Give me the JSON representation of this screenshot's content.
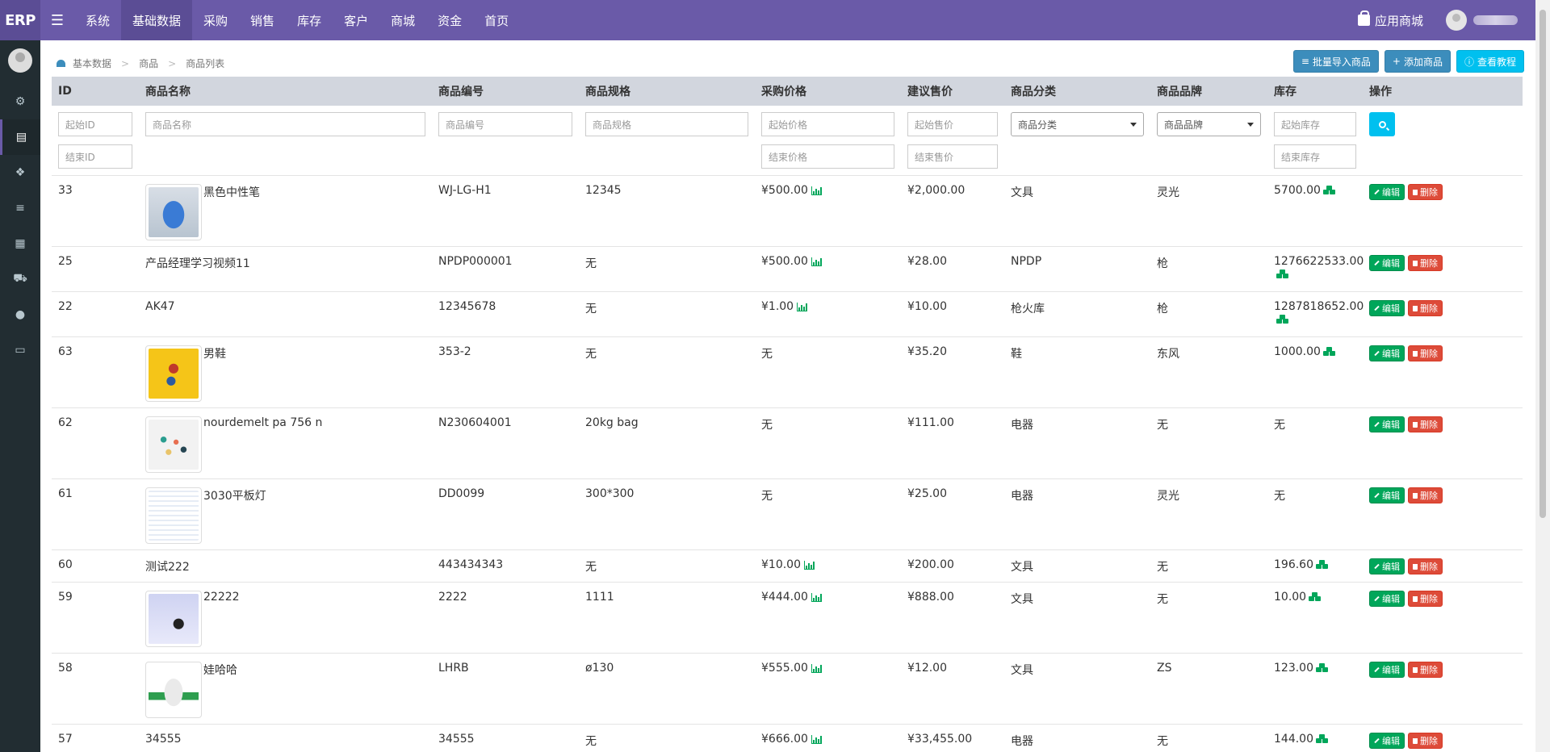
{
  "app": {
    "logo": "ERP"
  },
  "topnav": [
    {
      "label": "系统",
      "active": false
    },
    {
      "label": "基础数据",
      "active": true
    },
    {
      "label": "采购",
      "active": false
    },
    {
      "label": "销售",
      "active": false
    },
    {
      "label": "库存",
      "active": false
    },
    {
      "label": "客户",
      "active": false
    },
    {
      "label": "商城",
      "active": false
    },
    {
      "label": "资金",
      "active": false
    },
    {
      "label": "首页",
      "active": false
    }
  ],
  "topright": {
    "app_store": "应用商城"
  },
  "sidebar": [
    "gears-icon",
    "database-icon",
    "cubes-icon",
    "list-icon",
    "grid-icon",
    "cart-icon",
    "user-icon",
    "money-icon"
  ],
  "breadcrumb": [
    "基本数据",
    "商品",
    "商品列表"
  ],
  "toolbar": {
    "import": "批量导入商品",
    "add": "添加商品",
    "tutorial": "查看教程"
  },
  "columns": [
    "ID",
    "商品名称",
    "商品编号",
    "商品规格",
    "采购价格",
    "建议售价",
    "商品分类",
    "商品品牌",
    "库存",
    "操作"
  ],
  "filters": {
    "start_id": "起始ID",
    "end_id": "结束ID",
    "name": "商品名称",
    "code": "商品编号",
    "spec": "商品规格",
    "start_price": "起始价格",
    "end_price": "结束价格",
    "start_sale": "起始售价",
    "end_sale": "结束售价",
    "category": "商品分类",
    "brand": "商品品牌",
    "start_stock": "起始库存",
    "end_stock": "结束库存"
  },
  "actions": {
    "edit": "编辑",
    "delete": "删除"
  },
  "rows": [
    {
      "id": "33",
      "name": "黑色中性笔",
      "code": "WJ-LG-H1",
      "spec": "12345",
      "purchase": "¥500.00",
      "has_chart": true,
      "sale": "¥2,000.00",
      "category": "文具",
      "brand": "灵光",
      "stock": "5700.00",
      "has_stock_icon": true,
      "image": "detergent"
    },
    {
      "id": "25",
      "name": "产品经理学习视频11",
      "code": "NPDP000001",
      "spec": "无",
      "purchase": "¥500.00",
      "has_chart": true,
      "sale": "¥28.00",
      "category": "NPDP",
      "brand": "枪",
      "stock": "1276622533.00",
      "has_stock_icon": true,
      "image": ""
    },
    {
      "id": "22",
      "name": "AK47",
      "code": "12345678",
      "spec": "无",
      "purchase": "¥1.00",
      "has_chart": true,
      "sale": "¥10.00",
      "category": "枪火库",
      "brand": "枪",
      "stock": "1287818652.00",
      "has_stock_icon": true,
      "image": ""
    },
    {
      "id": "63",
      "name": "男鞋",
      "code": "353-2",
      "spec": "无",
      "purchase": "无",
      "has_chart": false,
      "sale": "¥35.20",
      "category": "鞋",
      "brand": "东风",
      "stock": "1000.00",
      "has_stock_icon": true,
      "image": "mario"
    },
    {
      "id": "62",
      "name": "nourdemelt pa 756 n",
      "code": "N230604001",
      "spec": "20kg bag",
      "purchase": "无",
      "has_chart": false,
      "sale": "¥111.00",
      "category": "电器",
      "brand": "无",
      "stock": "无",
      "has_stock_icon": false,
      "image": "markers"
    },
    {
      "id": "61",
      "name": "3030平板灯",
      "code": "DD0099",
      "spec": "300*300",
      "purchase": "无",
      "has_chart": false,
      "sale": "¥25.00",
      "category": "电器",
      "brand": "灵光",
      "stock": "无",
      "has_stock_icon": false,
      "image": "screenshot"
    },
    {
      "id": "60",
      "name": "测试222",
      "code": "443434343",
      "spec": "无",
      "purchase": "¥10.00",
      "has_chart": true,
      "sale": "¥200.00",
      "category": "文具",
      "brand": "无",
      "stock": "196.60",
      "has_stock_icon": true,
      "image": ""
    },
    {
      "id": "59",
      "name": "22222",
      "code": "2222",
      "spec": "1111",
      "purchase": "¥444.00",
      "has_chart": true,
      "sale": "¥888.00",
      "category": "文具",
      "brand": "无",
      "stock": "10.00",
      "has_stock_icon": true,
      "image": "poster"
    },
    {
      "id": "58",
      "name": "娃哈哈",
      "code": "LHRB",
      "spec": "ø130",
      "purchase": "¥555.00",
      "has_chart": true,
      "sale": "¥12.00",
      "category": "文具",
      "brand": "ZS",
      "stock": "123.00",
      "has_stock_icon": true,
      "image": "bottle"
    },
    {
      "id": "57",
      "name": "34555",
      "code": "34555",
      "spec": "无",
      "purchase": "¥666.00",
      "has_chart": true,
      "sale": "¥33,455.00",
      "category": "电器",
      "brand": "无",
      "stock": "144.00",
      "has_stock_icon": true,
      "image": ""
    }
  ]
}
